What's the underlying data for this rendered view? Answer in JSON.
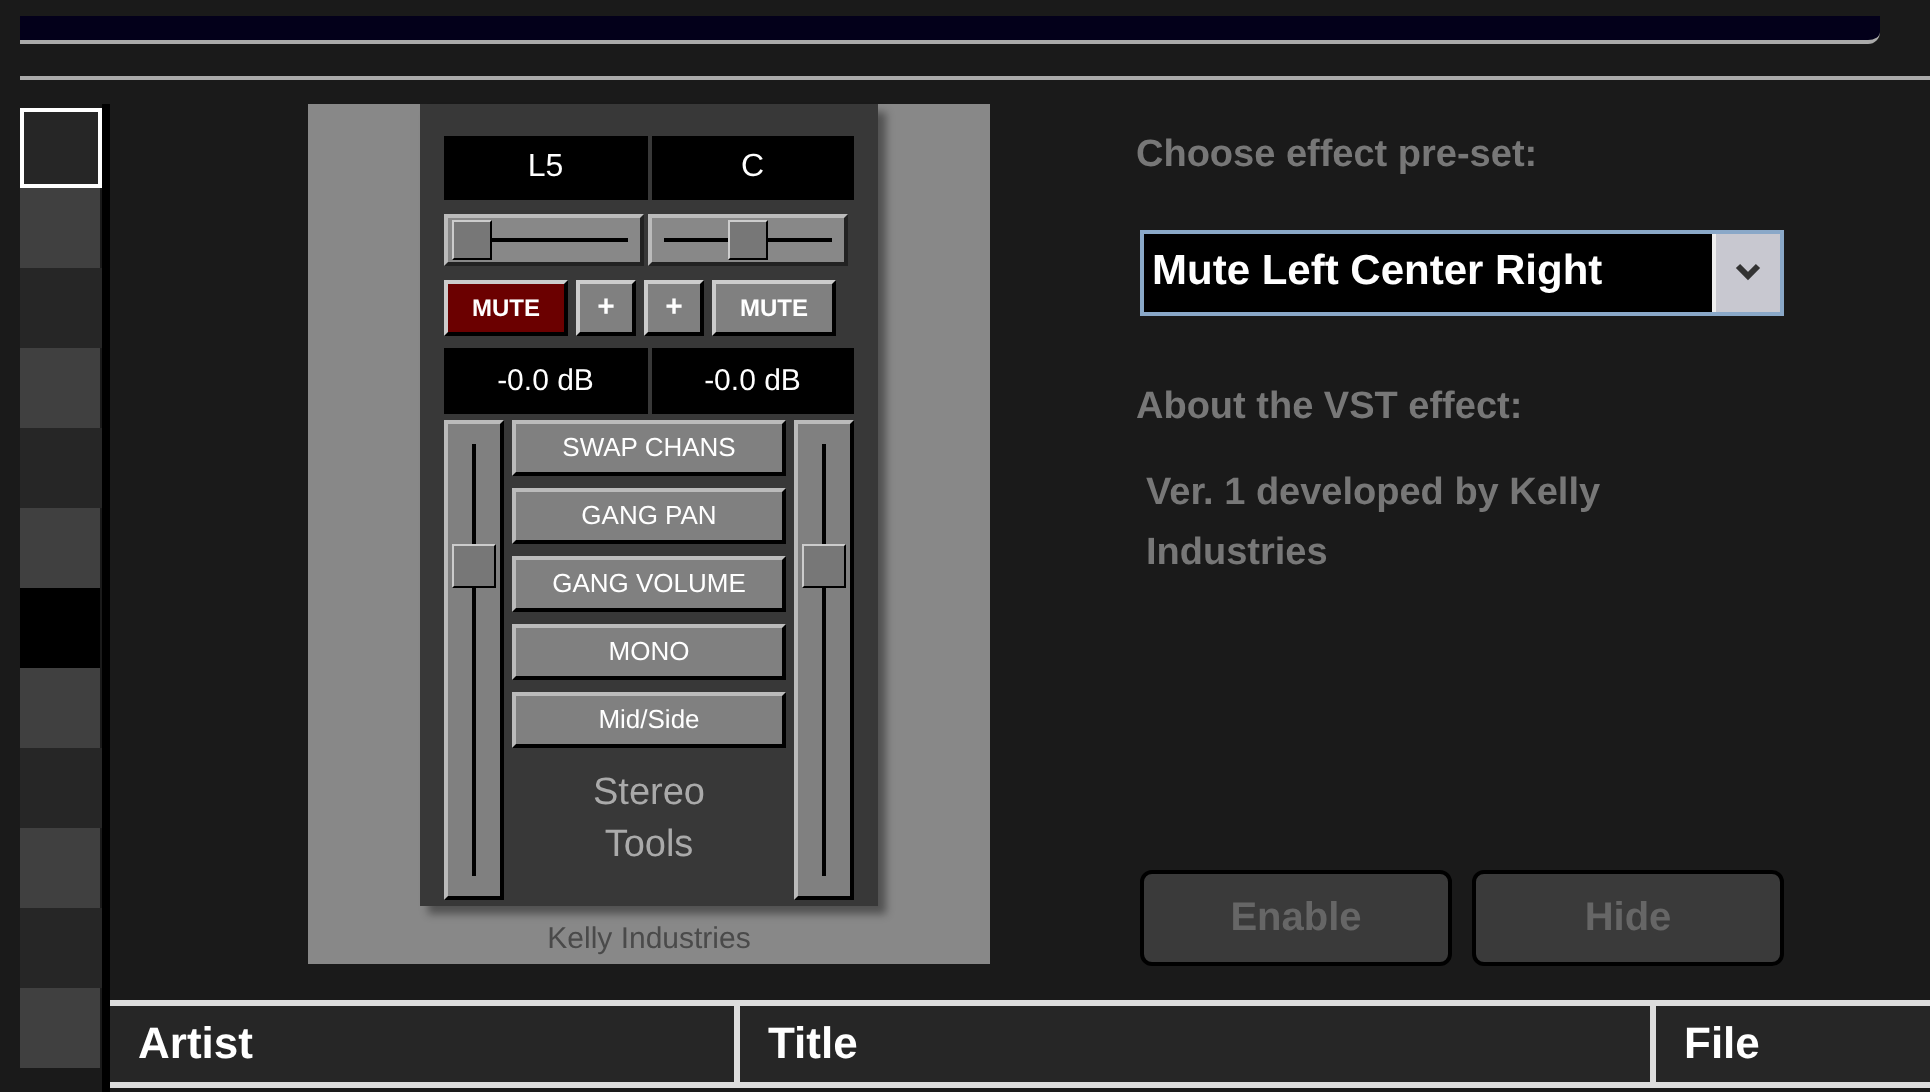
{
  "left_list": {
    "rows": [
      {
        "selected": false
      },
      {
        "selected": false
      },
      {
        "selected": false
      },
      {
        "selected": false
      },
      {
        "selected": false
      },
      {
        "selected": false
      },
      {
        "selected": true
      },
      {
        "selected": false
      },
      {
        "selected": false
      },
      {
        "selected": false
      },
      {
        "selected": false
      },
      {
        "selected": false
      }
    ]
  },
  "plugin": {
    "channels": [
      {
        "label": "L5",
        "pan": {
          "level": 0
        },
        "mute": {
          "label": "MUTE",
          "on": true
        },
        "plus": "+",
        "reading": "-0.0 dB",
        "volume": {
          "level": 0.72
        }
      },
      {
        "label": "C",
        "pan": {
          "level": 0.5
        },
        "mute": {
          "label": "MUTE",
          "on": false
        },
        "plus": "+",
        "reading": "-0.0 dB",
        "volume": {
          "level": 0.72
        }
      }
    ],
    "buttons": [
      {
        "label": "SWAP CHANS"
      },
      {
        "label": "GANG PAN"
      },
      {
        "label": "GANG VOLUME"
      },
      {
        "label": "MONO"
      },
      {
        "label": "Mid/Side"
      }
    ],
    "name": "Stereo Tools",
    "vendor": "Kelly Industries"
  },
  "effect": {
    "preset_label": "Choose effect pre-set:",
    "preset_value": "Mute Left Center Right",
    "about_label": "About the VST effect:",
    "about_text": "Ver. 1 developed by Kelly Industries",
    "buttons": [
      {
        "label": "Enable",
        "disabled": true
      },
      {
        "label": "Hide",
        "disabled": true
      }
    ]
  },
  "table": {
    "columns": [
      "Artist",
      "Title",
      "File"
    ]
  }
}
